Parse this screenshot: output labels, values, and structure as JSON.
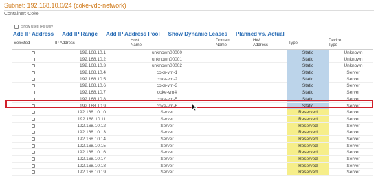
{
  "header": {
    "subnet": "Subnet: 192.168.10.0/24 (coke-vdc-network)",
    "container": "Container: Coke",
    "show_used": "Show Used IPs Only"
  },
  "actions": [
    "Add IP Address",
    "Add IP Range",
    "Add IP Address Pool",
    "Show Dynamic Leases",
    "Planned vs. Actual"
  ],
  "columns": {
    "selected": "Selected",
    "ip": "IP Address",
    "host": "Host\nName",
    "domain": "Domain\nName",
    "hw": "HW\nAddress",
    "type": "Type",
    "device": "Device\nType"
  },
  "rows": [
    {
      "ip": "192.168.10.1",
      "host": "unknown00000",
      "type": "Static",
      "device": "Unknown"
    },
    {
      "ip": "192.168.10.2",
      "host": "unknown00001",
      "type": "Static",
      "device": "Unknown"
    },
    {
      "ip": "192.168.10.3",
      "host": "unknown00002",
      "type": "Static",
      "device": "Unknown"
    },
    {
      "ip": "192.168.10.4",
      "host": "coke-vm-1",
      "type": "Static",
      "device": "Server"
    },
    {
      "ip": "192.168.10.5",
      "host": "coke-vm-2",
      "type": "Static",
      "device": "Server"
    },
    {
      "ip": "192.168.10.6",
      "host": "coke-vm-3",
      "type": "Static",
      "device": "Server"
    },
    {
      "ip": "192.168.10.7",
      "host": "coke-vm4",
      "type": "Static",
      "device": "Server"
    },
    {
      "ip": "192.168.10.8",
      "host": "coke-vm-5",
      "type": "Static",
      "device": "Server"
    },
    {
      "ip": "192.168.10.9",
      "host": "coke-vm-6",
      "type": "Static",
      "device": "Server"
    },
    {
      "ip": "192.168.10.10",
      "host": "Server",
      "type": "Reserved",
      "device": "Server"
    },
    {
      "ip": "192.168.10.11",
      "host": "Server",
      "type": "Reserved",
      "device": "Server"
    },
    {
      "ip": "192.168.10.12",
      "host": "Server",
      "type": "Reserved",
      "device": "Server"
    },
    {
      "ip": "192.168.10.13",
      "host": "Server",
      "type": "Reserved",
      "device": "Server"
    },
    {
      "ip": "192.168.10.14",
      "host": "Server",
      "type": "Reserved",
      "device": "Server"
    },
    {
      "ip": "192.168.10.15",
      "host": "Server",
      "type": "Reserved",
      "device": "Server"
    },
    {
      "ip": "192.168.10.16",
      "host": "Server",
      "type": "Reserved",
      "device": "Server"
    },
    {
      "ip": "192.168.10.17",
      "host": "Server",
      "type": "Reserved",
      "device": "Server"
    },
    {
      "ip": "192.168.10.18",
      "host": "Server",
      "type": "Reserved",
      "device": "Server"
    },
    {
      "ip": "192.168.10.19",
      "host": "Server",
      "type": "Reserved",
      "device": "Server"
    }
  ],
  "colors": {
    "subnet_title": "#d07a1a",
    "link": "#2a6db5",
    "static": "#bcd4ea",
    "reserved": "#f6ee8a",
    "highlight": "#d11f2a"
  },
  "icons": {
    "cursor": "mouse-pointer-icon"
  }
}
